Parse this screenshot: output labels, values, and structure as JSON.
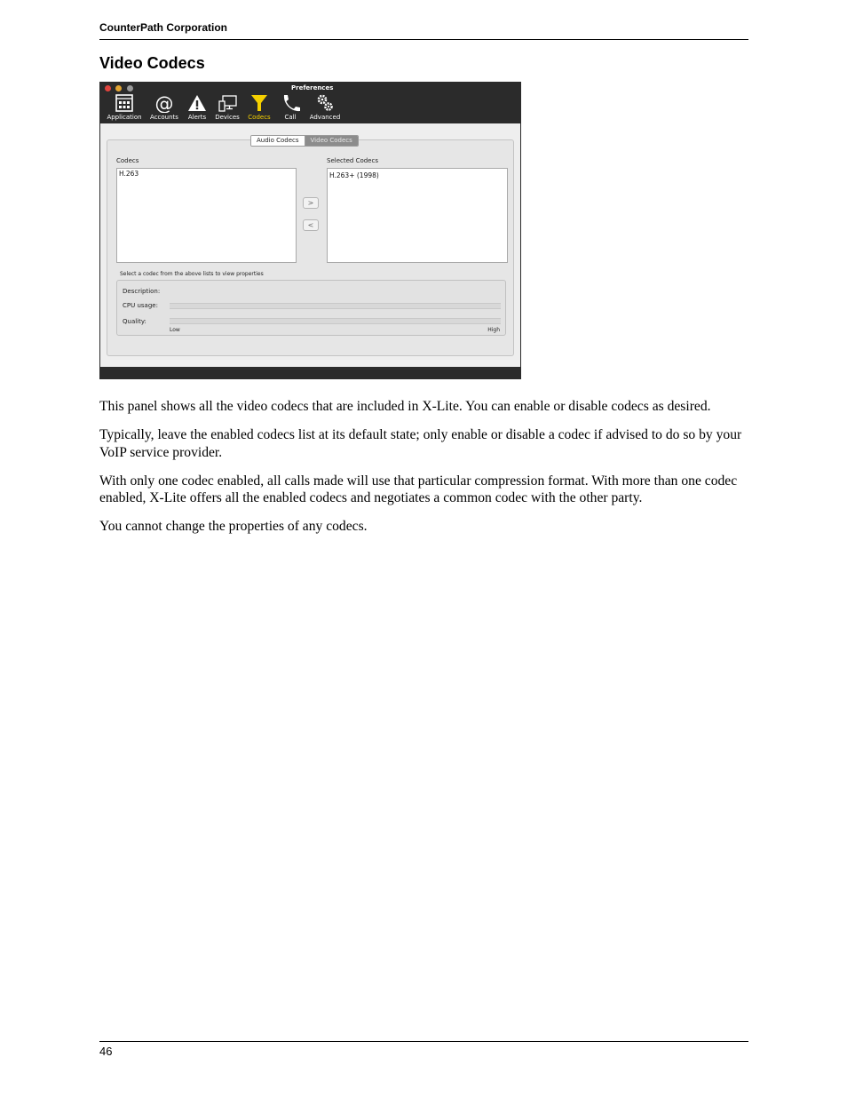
{
  "page": {
    "header": "CounterPath Corporation",
    "section_title": "Video Codecs",
    "page_number": "46",
    "paragraphs": [
      "This panel shows all the video codecs that are included in X-Lite. You can enable or disable codecs as desired.",
      "Typically, leave the enabled codecs list at its default state; only enable or disable a codec if advised to do so by your VoIP service provider.",
      "With only one codec enabled, all calls made will use that particular compression format. With more than one codec enabled, X-Lite offers all the enabled codecs and negotiates a common codec with the other party.",
      "You cannot change the properties of any codecs."
    ]
  },
  "window": {
    "title": "Preferences",
    "toolbar": [
      {
        "label": "Application",
        "icon": "application-icon"
      },
      {
        "label": "Accounts",
        "icon": "at-sign-icon"
      },
      {
        "label": "Alerts",
        "icon": "warning-icon"
      },
      {
        "label": "Devices",
        "icon": "devices-icon"
      },
      {
        "label": "Codecs",
        "icon": "funnel-icon",
        "active": true
      },
      {
        "label": "Call",
        "icon": "phone-icon"
      },
      {
        "label": "Advanced",
        "icon": "gears-icon"
      }
    ],
    "active_color": "#f5d000",
    "tabs": {
      "audio": "Audio Codecs",
      "video": "Video Codecs",
      "selected": "Video Codecs"
    },
    "codecs_label": "Codecs",
    "codecs": [
      "H.263"
    ],
    "selected_label": "Selected Codecs",
    "selected_codecs": [
      "H.263+ (1998)"
    ],
    "add_button": ">",
    "remove_button": "<",
    "hint": "Select a codec from the above lists to view properties",
    "properties": {
      "description_label": "Description:",
      "cpu_label": "CPU usage:",
      "quality_label": "Quality:",
      "low_label": "Low",
      "high_label": "High"
    }
  }
}
